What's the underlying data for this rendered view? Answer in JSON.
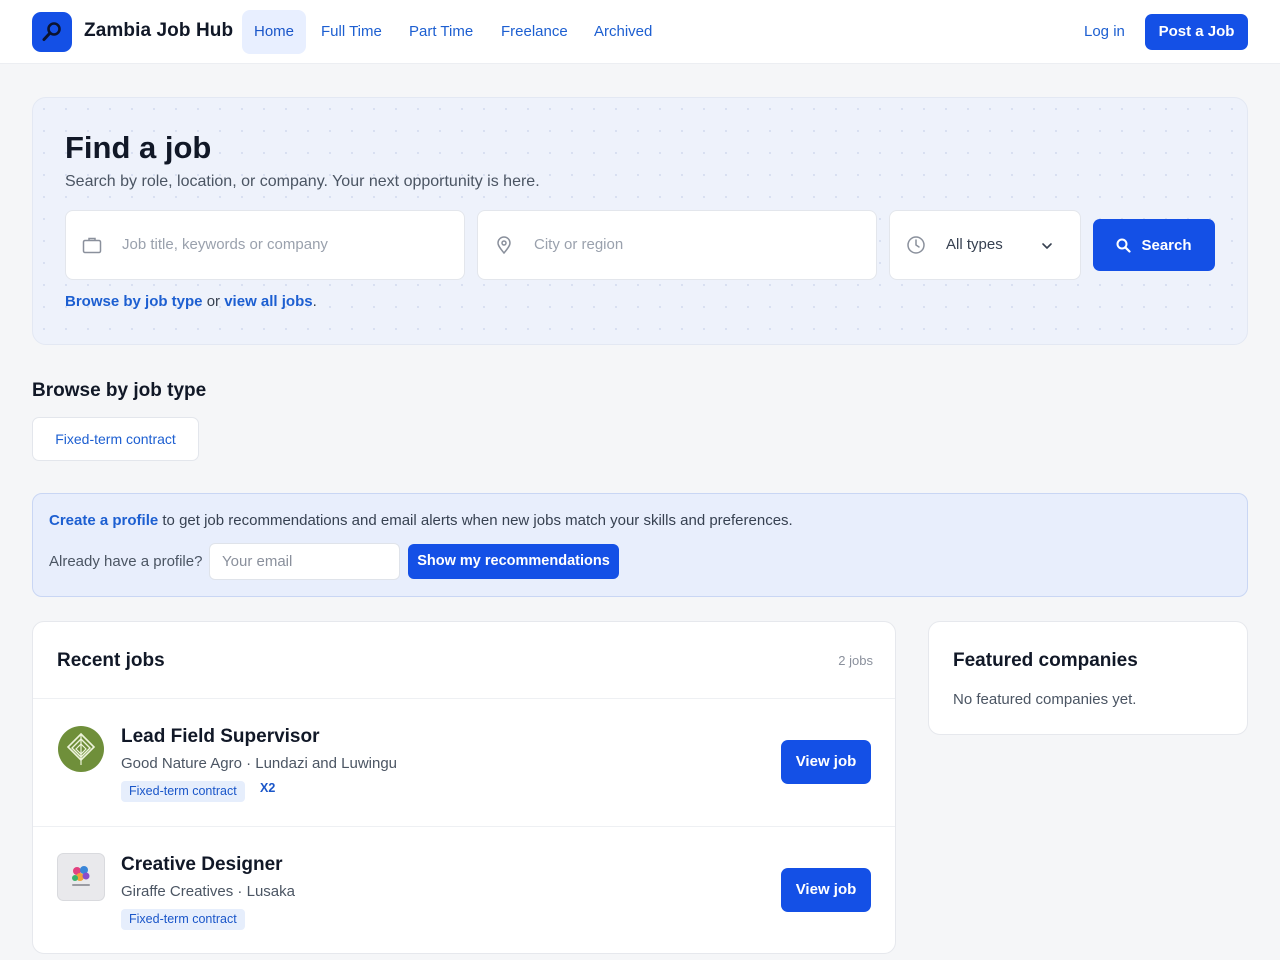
{
  "header": {
    "brand": "Zambia Job Hub",
    "nav": [
      {
        "label": "Home",
        "active": true
      },
      {
        "label": "Full Time"
      },
      {
        "label": "Part Time"
      },
      {
        "label": "Freelance"
      },
      {
        "label": "Archived"
      }
    ],
    "login_label": "Log in",
    "post_label": "Post a Job",
    "accent_color": "#1450e6"
  },
  "hero": {
    "title": "Find a job",
    "subtitle": "Search by role, location, or company. Your next opportunity is here.",
    "keyword_placeholder": "Job title, keywords or company",
    "location_placeholder": "City or region",
    "type_value": "All types",
    "search_label": "Search",
    "browse_link": "Browse by job type",
    "or_text": " or ",
    "view_all_link": "view all jobs",
    "period": "."
  },
  "browse": {
    "title": "Browse by job type",
    "types": [
      "Fixed-term contract"
    ]
  },
  "profile_banner": {
    "link": "Create a profile",
    "text": " to get job recommendations and email alerts when new jobs match your skills and preferences.",
    "question": "Already have a profile?",
    "email_placeholder": "Your email",
    "button": "Show my recommendations"
  },
  "recent_jobs": {
    "title": "Recent jobs",
    "count": "2 jobs",
    "items": [
      {
        "title": "Lead Field Supervisor",
        "meta": "Good Nature Agro · Lundazi and Luwingu",
        "tag": "Fixed-term contract",
        "multiplier": "X2",
        "button": "View job",
        "logo": "good-nature-agro-logo"
      },
      {
        "title": "Creative Designer",
        "meta": "Giraffe Creatives · Lusaka",
        "tag": "Fixed-term contract",
        "button": "View job",
        "logo": "giraffe-creatives-logo"
      }
    ]
  },
  "featured": {
    "title": "Featured companies",
    "empty_text": "No featured companies yet."
  }
}
